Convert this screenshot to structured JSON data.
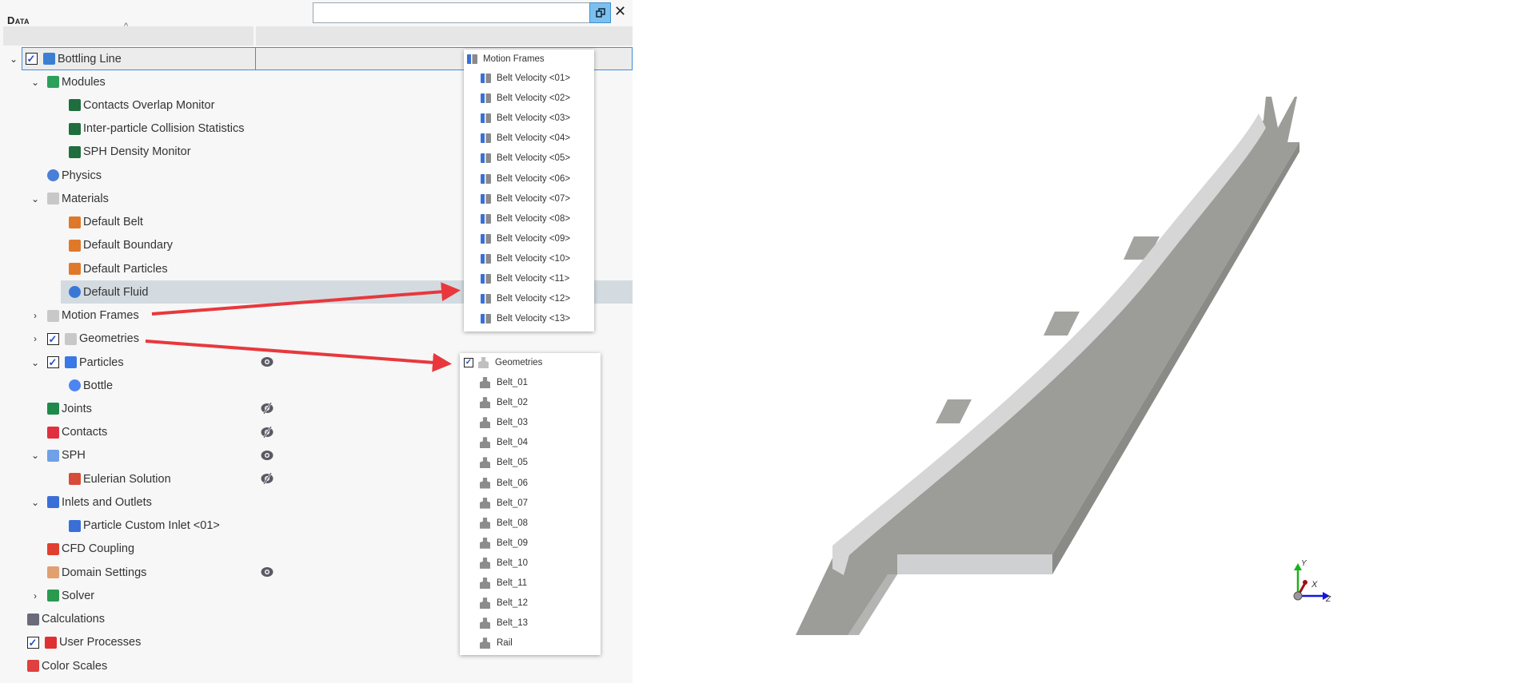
{
  "panel": {
    "title": "Data",
    "search_value": "",
    "sort_indicator": "^",
    "close": "✕"
  },
  "tree": [
    {
      "label": "Bottling Line",
      "level": 0,
      "chevron": "down",
      "checkbox": true,
      "icon": "clipboard-icon",
      "color": "#3b7fd4",
      "root": true
    },
    {
      "label": "Modules",
      "level": 1,
      "chevron": "down",
      "icon": "module-icon",
      "color": "#2aa05a"
    },
    {
      "label": "Contacts Overlap Monitor",
      "level": 2,
      "icon": "module-icon",
      "color": "#1f6e3e"
    },
    {
      "label": "Inter-particle Collision Statistics",
      "level": 2,
      "icon": "module-icon",
      "color": "#1f6e3e"
    },
    {
      "label": "SPH Density Monitor",
      "level": 2,
      "icon": "module-icon",
      "color": "#1f6e3e"
    },
    {
      "label": "Physics",
      "level": 1,
      "icon": "physics-icon",
      "color": "#4a7fd8"
    },
    {
      "label": "Materials",
      "level": 1,
      "chevron": "down",
      "icon": "materials-folder-icon",
      "color": "#c8c8c8"
    },
    {
      "label": "Default Belt",
      "level": 2,
      "icon": "material-icon",
      "color": "#e0782a"
    },
    {
      "label": "Default Boundary",
      "level": 2,
      "icon": "material-icon",
      "color": "#e0782a"
    },
    {
      "label": "Default Particles",
      "level": 2,
      "icon": "material-icon",
      "color": "#e0782a"
    },
    {
      "label": "Default Fluid",
      "level": 2,
      "icon": "fluid-drop-icon",
      "color": "#3a78d8",
      "selected": true
    },
    {
      "label": "Motion Frames",
      "level": 1,
      "chevron": "right",
      "icon": "motion-frames-folder-icon",
      "color": "#c8c8c8"
    },
    {
      "label": "Geometries",
      "level": 1,
      "chevron": "right",
      "checkbox": true,
      "icon": "geometries-folder-icon",
      "color": "#c8c8c8"
    },
    {
      "label": "Particles",
      "level": 1,
      "chevron": "down",
      "checkbox": true,
      "icon": "particles-folder-icon",
      "color": "#3a78e8",
      "eye": "visible"
    },
    {
      "label": "Bottle",
      "level": 2,
      "icon": "particle-dot-icon",
      "color": "#4d86f0"
    },
    {
      "label": "Joints",
      "level": 1,
      "icon": "joints-icon",
      "color": "#1f8a4a",
      "eye": "hidden"
    },
    {
      "label": "Contacts",
      "level": 1,
      "icon": "contacts-icon",
      "color": "#e03040",
      "eye": "hidden"
    },
    {
      "label": "SPH",
      "level": 1,
      "chevron": "down",
      "icon": "sph-waves-icon",
      "color": "#6fa0e8",
      "eye": "visible"
    },
    {
      "label": "Eulerian Solution",
      "level": 2,
      "icon": "eulerian-icon",
      "color": "#d84a3a",
      "eye": "hidden"
    },
    {
      "label": "Inlets and Outlets",
      "level": 1,
      "chevron": "down",
      "icon": "inlets-folder-icon",
      "color": "#3a6fd8"
    },
    {
      "label": "Particle Custom Inlet <01>",
      "level": 2,
      "icon": "inlet-icon",
      "color": "#3a6fd8"
    },
    {
      "label": "CFD Coupling",
      "level": 1,
      "icon": "cfd-coupling-icon",
      "color": "#e04030"
    },
    {
      "label": "Domain Settings",
      "level": 1,
      "icon": "domain-settings-icon",
      "color": "#e0a070",
      "eye": "visible"
    },
    {
      "label": "Solver",
      "level": 1,
      "chevron": "right",
      "icon": "solver-gears-icon",
      "color": "#2a9a50"
    },
    {
      "label": "Calculations",
      "level": 0,
      "icon": "calculator-icon",
      "color": "#6a6a7a"
    },
    {
      "label": "User Processes",
      "level": 0,
      "checkbox": true,
      "icon": "user-process-wave-icon",
      "color": "#e03030"
    },
    {
      "label": "Color Scales",
      "level": 0,
      "icon": "color-scales-icon",
      "color": "#e04040"
    }
  ],
  "motion_popup": {
    "header": "Motion Frames",
    "items": [
      "Belt Velocity <01>",
      "Belt Velocity <02>",
      "Belt Velocity <03>",
      "Belt Velocity <04>",
      "Belt Velocity <05>",
      "Belt Velocity <06>",
      "Belt Velocity <07>",
      "Belt Velocity <08>",
      "Belt Velocity <09>",
      "Belt Velocity <10>",
      "Belt Velocity <11>",
      "Belt Velocity <12>",
      "Belt Velocity <13>"
    ]
  },
  "geometry_popup": {
    "header": "Geometries",
    "checked": true,
    "items": [
      "Belt_01",
      "Belt_02",
      "Belt_03",
      "Belt_04",
      "Belt_05",
      "Belt_06",
      "Belt_07",
      "Belt_08",
      "Belt_09",
      "Belt_10",
      "Belt_11",
      "Belt_12",
      "Belt_13",
      "Rail"
    ]
  },
  "axes": {
    "y": "Y",
    "x": "X",
    "z": "Z"
  },
  "colors": {
    "accent": "#3c8fdc",
    "arrow": "#e8383d",
    "selection": "#d3dbe1",
    "geometry": "#9c9c98"
  }
}
